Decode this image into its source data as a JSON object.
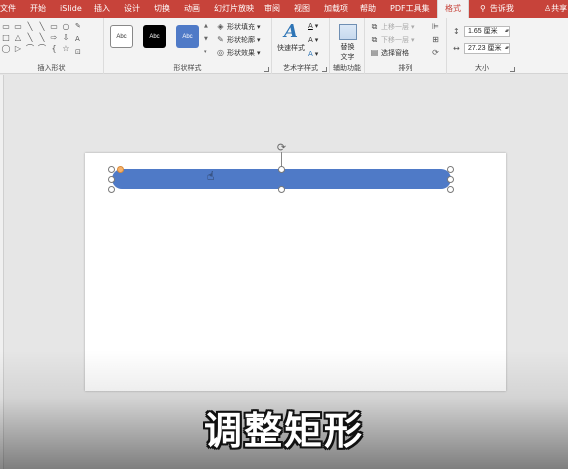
{
  "tabs": [
    {
      "label": "文件"
    },
    {
      "label": "开始"
    },
    {
      "label": "iSlide"
    },
    {
      "label": "插入"
    },
    {
      "label": "设计"
    },
    {
      "label": "切换"
    },
    {
      "label": "动画"
    },
    {
      "label": "幻灯片放映"
    },
    {
      "label": "审阅"
    },
    {
      "label": "视图"
    },
    {
      "label": "加载项"
    },
    {
      "label": "帮助"
    },
    {
      "label": "PDF工具集"
    },
    {
      "label": "格式"
    }
  ],
  "active_tab": "格式",
  "tell_me": {
    "label": "告诉我",
    "icon": "lightbulb-icon"
  },
  "share": {
    "label": "共享",
    "icon": "person-icon"
  },
  "colors": {
    "accent": "#c7433a",
    "shape_fill": "#4f7ac7",
    "style_dark": "#000000"
  },
  "groups": {
    "insert_shapes": {
      "label": "插入形状",
      "shape_glyphs": [
        "▭",
        "▭",
        "╲",
        "╲",
        "▭",
        "○",
        "□",
        "△",
        "╲",
        "╲",
        "⇨",
        "⇩",
        "◯",
        "▷",
        "⌒",
        "⌒",
        "{",
        "☆"
      ],
      "side_tools": [
        "✎",
        "A",
        "⊡"
      ]
    },
    "shape_styles": {
      "label": "形状样式",
      "presets": [
        {
          "text": "Abc"
        },
        {
          "text": "Abc"
        },
        {
          "text": "Abc"
        }
      ],
      "commands": [
        {
          "label": "形状填充"
        },
        {
          "label": "形状轮廓"
        },
        {
          "label": "形状效果"
        }
      ]
    },
    "wordart": {
      "label": "艺术字样式",
      "quick_styles": "快速样式",
      "glyph": "A",
      "small_glyphs": [
        "A",
        "A",
        "A"
      ]
    },
    "accessibility": {
      "label": "辅助功能",
      "alt_text_line1": "替换",
      "alt_text_line2": "文字"
    },
    "arrange": {
      "label": "排列",
      "commands": [
        {
          "label": "上移一层"
        },
        {
          "label": "下移一层"
        },
        {
          "label": "选择窗格"
        }
      ]
    },
    "size": {
      "label": "大小",
      "height": "1.65 厘米",
      "width": "27.23 厘米"
    }
  },
  "caption": "调整矩形"
}
